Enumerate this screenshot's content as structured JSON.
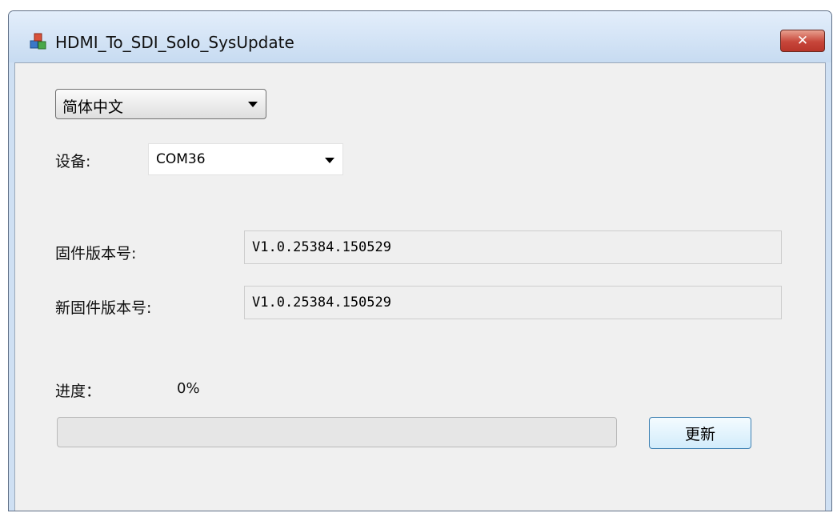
{
  "window": {
    "title": "HDMI_To_SDI_Solo_SysUpdate",
    "close_label": "✕"
  },
  "language": {
    "selected": "简体中文"
  },
  "device": {
    "label": "设备:",
    "selected": "COM36"
  },
  "firmware": {
    "label": "固件版本号:",
    "value": "V1.0.25384.150529"
  },
  "new_firmware": {
    "label": "新固件版本号:",
    "value": "V1.0.25384.150529"
  },
  "progress": {
    "label": "进度：",
    "percent_text": "0%",
    "value": 0
  },
  "actions": {
    "update_label": "更新"
  },
  "colors": {
    "titlebar": "#cfe0f3",
    "client_bg": "#f0f0f0",
    "close_red": "#c7463a",
    "button_border": "#3c7fb1"
  },
  "icons": {
    "app": "app-cubes-icon",
    "close": "close-icon",
    "dropdown": "chevron-down-icon"
  }
}
